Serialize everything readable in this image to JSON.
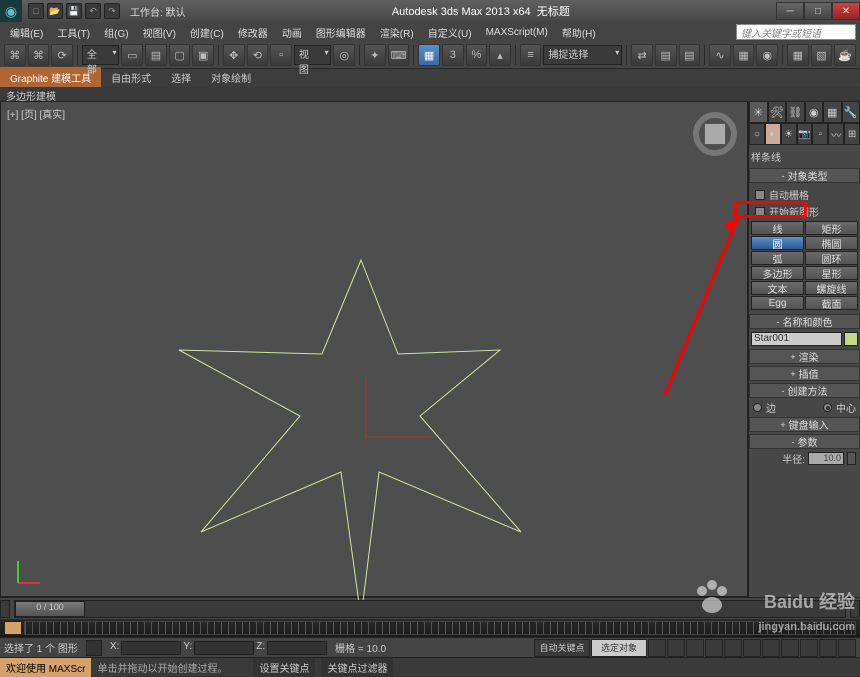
{
  "title": {
    "app": "Autodesk 3ds Max  2013  x64",
    "doc": "无标题",
    "workspace": "工作台: 默认"
  },
  "menu": {
    "items": [
      "编辑(E)",
      "工具(T)",
      "组(G)",
      "视图(V)",
      "创建(C)",
      "修改器",
      "动画",
      "图形编辑器",
      "渲染(R)",
      "自定义(U)",
      "MAXScript(M)",
      "帮助(H)"
    ],
    "search_ph": "键入关键字或短语"
  },
  "toolbar": {
    "sel_filter": "全部",
    "view_lbl": "视图",
    "snap_drop": "捕捉选择"
  },
  "ribbon": {
    "tabs": [
      "Graphite 建模工具",
      "自由形式",
      "选择",
      "对象绘制"
    ],
    "bar": "多边形建模"
  },
  "viewport": {
    "label": "[+] [页] [真实]"
  },
  "panel": {
    "category_drop": "样条线",
    "roll_objtype": "对象类型",
    "auto_grid": "自动栅格",
    "start_shape": "开始新图形",
    "buttons": {
      "line": "线",
      "rect": "矩形",
      "circle": "圆",
      "ellipse": "椭圆",
      "arc": "弧",
      "donut": "圆环",
      "ngon": "多边形",
      "star": "星形",
      "text": "文本",
      "helix": "螺旋线",
      "egg": "Egg",
      "section": "截面"
    },
    "roll_name": "名称和颜色",
    "obj_name": "Star001",
    "roll_render": "渲染",
    "roll_interp": "插值",
    "roll_create": "创建方法",
    "edge": "边",
    "center": "中心",
    "roll_kb": "键盘输入",
    "roll_params": "参数",
    "radius_lbl": "半径:",
    "radius_val": "10.0"
  },
  "time": {
    "slider": "0 / 100"
  },
  "status": {
    "selection": "选择了 1 个 图形",
    "x": "X:",
    "y": "Y:",
    "z": "Z:",
    "grid": "栅格 = 10.0",
    "autokey": "自动关键点",
    "setkey": "设置关键点",
    "keyfilter": "关键点过滤器",
    "sel_drop": "选定对象",
    "prompt_tab": "欢迎使用  MAXScr",
    "prompt_txt": "单击并拖动以开始创建过程。"
  },
  "watermark": {
    "brand": "Baidu 经验",
    "url": "jingyan.baidu.com"
  }
}
